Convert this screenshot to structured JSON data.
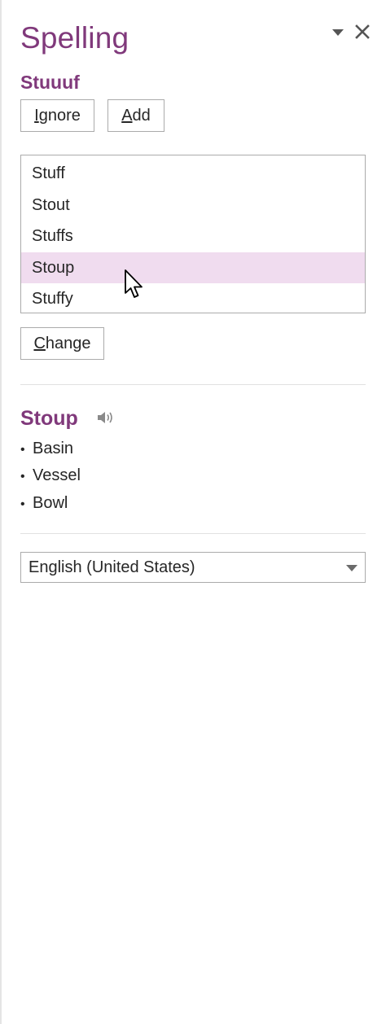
{
  "pane": {
    "title": "Spelling"
  },
  "misspelled": {
    "word": "Stuuuf"
  },
  "buttons": {
    "ignore_first": "I",
    "ignore_rest": "gnore",
    "add_first": "A",
    "add_rest": "dd",
    "change_first": "C",
    "change_rest": "hange"
  },
  "suggestions": [
    {
      "label": "Stuff",
      "selected": false
    },
    {
      "label": "Stout",
      "selected": false
    },
    {
      "label": "Stuffs",
      "selected": false
    },
    {
      "label": "Stoup",
      "selected": true
    },
    {
      "label": "Stuffy",
      "selected": false
    }
  ],
  "definition": {
    "word": "Stoup",
    "synonyms": [
      "Basin",
      "Vessel",
      "Bowl"
    ]
  },
  "language": {
    "selected": "English (United States)"
  },
  "colors": {
    "accent": "#80397b",
    "selection": "#f0dcef",
    "border": "#ababab",
    "text": "#262626"
  },
  "icons": {
    "options": "chevron-down-icon",
    "close": "close-icon",
    "speaker": "speaker-icon",
    "pointer": "mouse-cursor-icon"
  }
}
